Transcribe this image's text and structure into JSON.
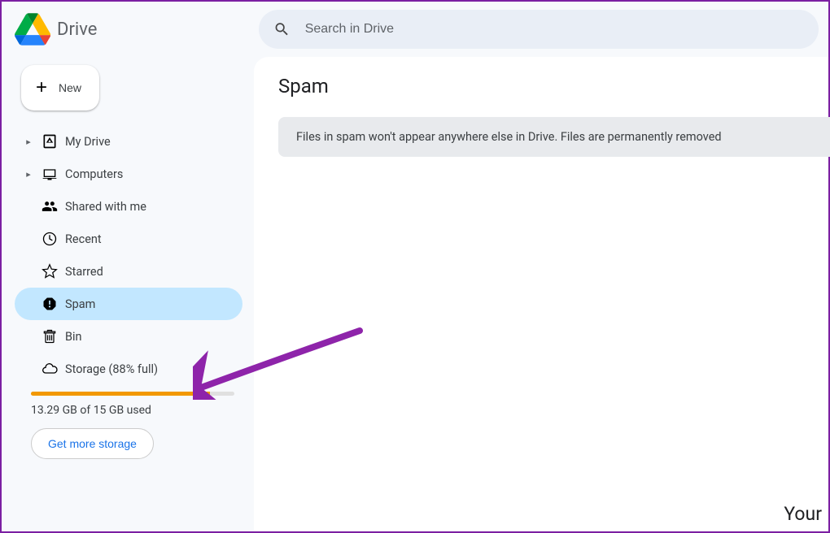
{
  "header": {
    "app_name": "Drive",
    "search_placeholder": "Search in Drive"
  },
  "sidebar": {
    "new_button": "New",
    "items": [
      {
        "label": "My Drive",
        "icon": "my-drive-icon",
        "expandable": true,
        "active": false
      },
      {
        "label": "Computers",
        "icon": "computers-icon",
        "expandable": true,
        "active": false
      },
      {
        "label": "Shared with me",
        "icon": "shared-icon",
        "expandable": false,
        "active": false
      },
      {
        "label": "Recent",
        "icon": "recent-icon",
        "expandable": false,
        "active": false
      },
      {
        "label": "Starred",
        "icon": "starred-icon",
        "expandable": false,
        "active": false
      },
      {
        "label": "Spam",
        "icon": "spam-icon",
        "expandable": false,
        "active": true
      },
      {
        "label": "Bin",
        "icon": "bin-icon",
        "expandable": false,
        "active": false
      },
      {
        "label": "Storage (88% full)",
        "icon": "cloud-icon",
        "expandable": false,
        "active": false
      }
    ],
    "storage": {
      "percent": 88,
      "used_text": "13.29 GB of 15 GB used",
      "cta_label": "Get more storage"
    }
  },
  "main": {
    "title": "Spam",
    "banner_text": "Files in spam won't appear anywhere else in Drive. Files are permanently removed",
    "corner_text": "Your"
  }
}
